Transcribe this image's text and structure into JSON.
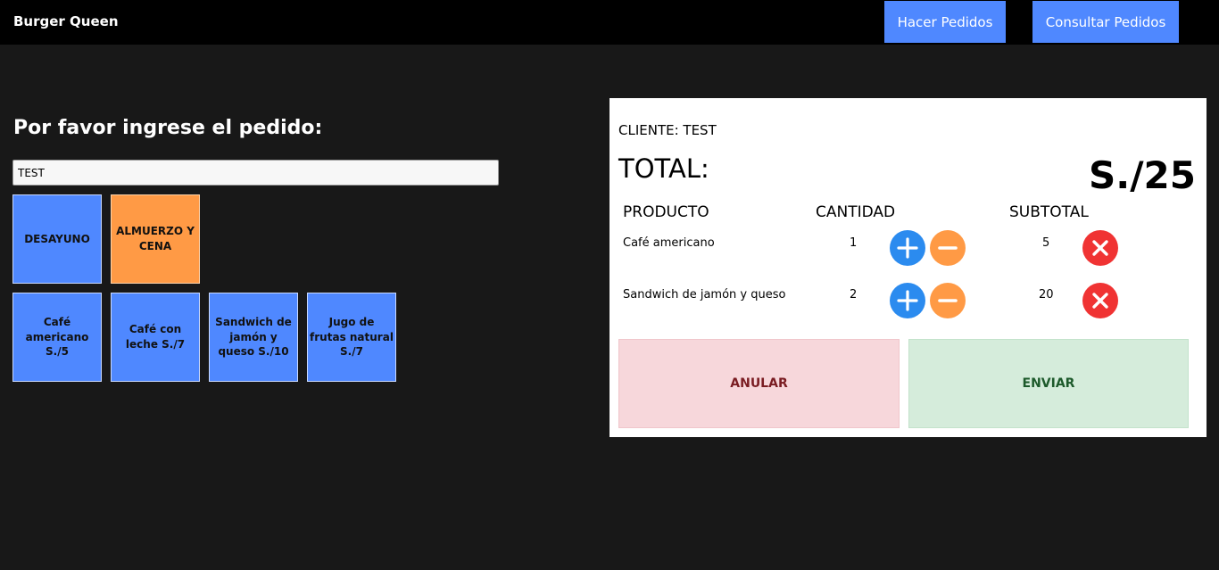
{
  "header": {
    "brand": "Burger Queen",
    "nav": [
      "Hacer Pedidos",
      "Consultar Pedidos"
    ]
  },
  "order_form": {
    "prompt": "Por favor ingrese el pedido:",
    "client_name_value": "TEST",
    "categories": [
      {
        "label": "DESAYUNO",
        "color": "#4f88ff"
      },
      {
        "label": "ALMUERZO Y CENA",
        "color": "#ff9a45"
      }
    ],
    "products": [
      {
        "label": "Café americano S./5"
      },
      {
        "label": "Café con leche S./7"
      },
      {
        "label": "Sandwich de jamón y queso S./10"
      },
      {
        "label": "Jugo de frutas natural S./7"
      }
    ]
  },
  "summary": {
    "client": "CLIENTE: TEST",
    "total_label": "TOTAL:",
    "total_value": "S./25",
    "columns": [
      "PRODUCTO",
      "CANTIDAD",
      "SUBTOTAL"
    ],
    "rows": [
      {
        "product": "Café americano",
        "qty": "1",
        "subtotal": "5"
      },
      {
        "product": "Sandwich de jamón y queso",
        "qty": "2",
        "subtotal": "20"
      }
    ],
    "cancel_label": "ANULAR",
    "send_label": "ENVIAR"
  },
  "icons": {
    "add": "plus-circle-icon",
    "remove": "minus-circle-icon",
    "delete": "x-circle-icon"
  }
}
